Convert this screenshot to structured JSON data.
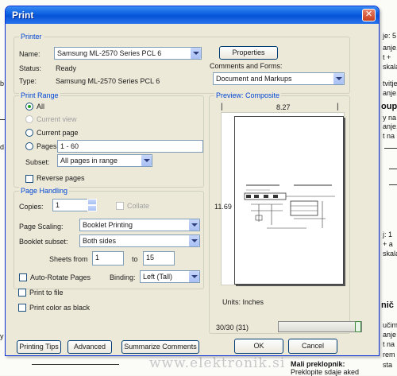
{
  "background": {
    "right_lines": [
      "je: 5",
      "anje.",
      "t +",
      "skala",
      "tvitje",
      "anje.",
      "oupe",
      "y na",
      "anje.",
      "t na",
      "j: 1",
      "+ a",
      "skala",
      "nič",
      "učim",
      "anje",
      "t na",
      "rem",
      "sta"
    ],
    "left_lines": [
      "b",
      "d",
      "y"
    ],
    "bottom_lines": [
      "Mali preklopnik:",
      "Preklopite sdaje aked"
    ],
    "watermark": "www.elektronik.si"
  },
  "dialog": {
    "title": "Print",
    "close_symbol": "✕",
    "printer": {
      "group_label": "Printer",
      "name_label": "Name:",
      "name_value": "Samsung ML-2570 Series PCL 6",
      "properties_label": "Properties",
      "status_label": "Status:",
      "status_value": "Ready",
      "type_label": "Type:",
      "type_value": "Samsung ML-2570 Series PCL 6",
      "comments_label": "Comments and Forms:",
      "comments_value": "Document and Markups"
    },
    "print_range": {
      "group_label": "Print Range",
      "all_label": "All",
      "current_view_label": "Current view",
      "current_page_label": "Current page",
      "pages_label": "Pages",
      "pages_value": "1 - 60",
      "subset_label": "Subset:",
      "subset_value": "All pages in range",
      "reverse_label": "Reverse pages"
    },
    "page_handling": {
      "group_label": "Page Handling",
      "copies_label": "Copies:",
      "copies_value": "1",
      "collate_label": "Collate",
      "scaling_label": "Page Scaling:",
      "scaling_value": "Booklet Printing",
      "booklet_label": "Booklet subset:",
      "booklet_value": "Both sides",
      "sheets_label": "Sheets from",
      "sheets_from": "1",
      "sheets_to_label": "to",
      "sheets_to": "15",
      "auto_rotate_label": "Auto-Rotate Pages",
      "binding_label": "Binding:",
      "binding_value": "Left (Tall)"
    },
    "print_to_file_label": "Print to file",
    "print_color_label": "Print color as black",
    "preview": {
      "group_label": "Preview: Composite",
      "width_label": "8.27",
      "height_label": "11.69",
      "units_label": "Units: Inches",
      "page_counter": "30/30 (31)",
      "progress": 1.0
    },
    "buttons": {
      "printing_tips": "Printing Tips",
      "advanced": "Advanced",
      "summarize": "Summarize Comments",
      "ok": "OK",
      "cancel": "Cancel"
    }
  }
}
